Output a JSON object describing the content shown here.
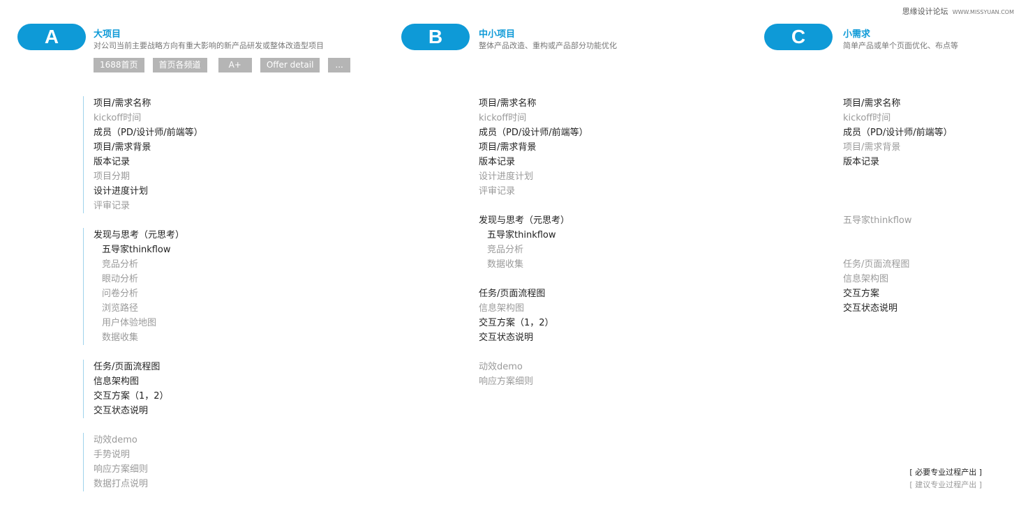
{
  "watermark": {
    "text": "思缘设计论坛",
    "site": "WWW.MISSYUAN.COM"
  },
  "columns": {
    "a": {
      "letter": "A",
      "title": "大项目",
      "subtitle": "对公司当前主要战略方向有重大影响的新产品研发或整体改造型项目",
      "tags": [
        "1688首页",
        "首页各频道",
        "A+",
        "Offer detail",
        "..."
      ],
      "g1": [
        [
          "项目/需求名称",
          "dark"
        ],
        [
          "kickoff时间",
          "light"
        ],
        [
          "成员（PD/设计师/前端等）",
          "dark"
        ],
        [
          "项目/需求背景",
          "dark"
        ],
        [
          "版本记录",
          "dark"
        ],
        [
          "项目分期",
          "light"
        ],
        [
          "设计进度计划",
          "dark"
        ],
        [
          "评审记录",
          "light"
        ]
      ],
      "g2": [
        [
          "发现与思考（元思考）",
          "dark",
          0
        ],
        [
          "五导家thinkflow",
          "dark",
          1
        ],
        [
          "竞品分析",
          "light",
          1
        ],
        [
          "眼动分析",
          "light",
          1
        ],
        [
          "问卷分析",
          "light",
          1
        ],
        [
          "浏览路径",
          "light",
          1
        ],
        [
          "用户体验地图",
          "light",
          1
        ],
        [
          "数据收集",
          "light",
          1
        ]
      ],
      "g3": [
        [
          "任务/页面流程图",
          "dark"
        ],
        [
          "信息架构图",
          "dark"
        ],
        [
          "交互方案（1，2）",
          "dark"
        ],
        [
          "交互状态说明",
          "dark"
        ]
      ],
      "g4": [
        [
          "动效demo",
          "light"
        ],
        [
          "手势说明",
          "light"
        ],
        [
          "响应方案细则",
          "light"
        ],
        [
          "数据打点说明",
          "light"
        ]
      ]
    },
    "b": {
      "letter": "B",
      "title": "中小项目",
      "subtitle": "整体产品改造、重构或产品部分功能优化",
      "g1": [
        [
          "项目/需求名称",
          "dark"
        ],
        [
          "kickoff时间",
          "light"
        ],
        [
          "成员（PD/设计师/前端等）",
          "dark"
        ],
        [
          "项目/需求背景",
          "dark"
        ],
        [
          "版本记录",
          "dark"
        ],
        [
          "设计进度计划",
          "light"
        ],
        [
          "评审记录",
          "light"
        ]
      ],
      "g2": [
        [
          "发现与思考（元思考）",
          "dark",
          0
        ],
        [
          "五导家thinkflow",
          "dark",
          1
        ],
        [
          "竞品分析",
          "light",
          1
        ],
        [
          "数据收集",
          "light",
          1
        ]
      ],
      "g3": [
        [
          "任务/页面流程图",
          "dark"
        ],
        [
          "信息架构图",
          "light"
        ],
        [
          "交互方案（1，2）",
          "dark"
        ],
        [
          "交互状态说明",
          "dark"
        ]
      ],
      "g4": [
        [
          "动效demo",
          "light"
        ],
        [
          "响应方案细则",
          "light"
        ]
      ]
    },
    "c": {
      "letter": "C",
      "title": "小需求",
      "subtitle": "简单产品或单个页面优化、布点等",
      "g1": [
        [
          "项目/需求名称",
          "dark"
        ],
        [
          "kickoff时间",
          "light"
        ],
        [
          "成员（PD/设计师/前端等）",
          "dark"
        ],
        [
          "项目/需求背景",
          "light"
        ],
        [
          "版本记录",
          "dark"
        ]
      ],
      "g2": [
        [
          "五导家thinkflow",
          "light",
          0
        ]
      ],
      "g3": [
        [
          "任务/页面流程图",
          "light"
        ],
        [
          "信息架构图",
          "light"
        ],
        [
          "交互方案",
          "dark"
        ],
        [
          "交互状态说明",
          "dark"
        ]
      ]
    }
  },
  "legend": {
    "required": "[ 必要专业过程产出 ]",
    "suggested": "[ 建议专业过程产出 ]"
  },
  "colors": {
    "accent": "#0e9ad7",
    "dark_text": "#222222",
    "light_text": "#9a9a9a",
    "tag_bg": "#b5b5b5",
    "bar": "#9fd3ec"
  }
}
